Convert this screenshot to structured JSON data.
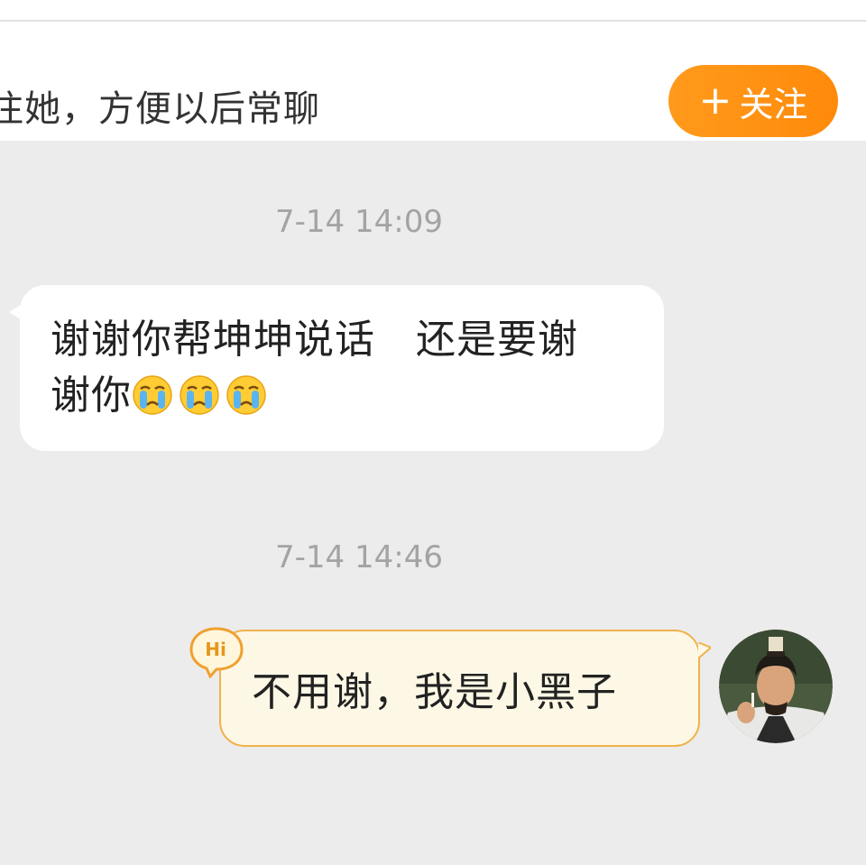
{
  "follow_bar": {
    "text": "注她，方便以后常聊",
    "button_label": "关注",
    "button_icon": "plus-icon"
  },
  "messages": [
    {
      "timestamp": "7-14 14:09",
      "from": "other",
      "line1": "谢谢你帮坤坤说话　还是要谢",
      "line2": "谢你",
      "emojis": [
        "crying-face-emoji",
        "crying-face-emoji",
        "crying-face-emoji"
      ]
    },
    {
      "timestamp": "7-14 14:46",
      "from": "self",
      "text": "不用谢，我是小黑子",
      "badge": "Hi"
    }
  ],
  "colors": {
    "accent": "#ff8f12",
    "bubble_self_bg": "#fdf8e6",
    "bubble_self_border": "#f0b24b",
    "page_bg": "#ececec"
  }
}
